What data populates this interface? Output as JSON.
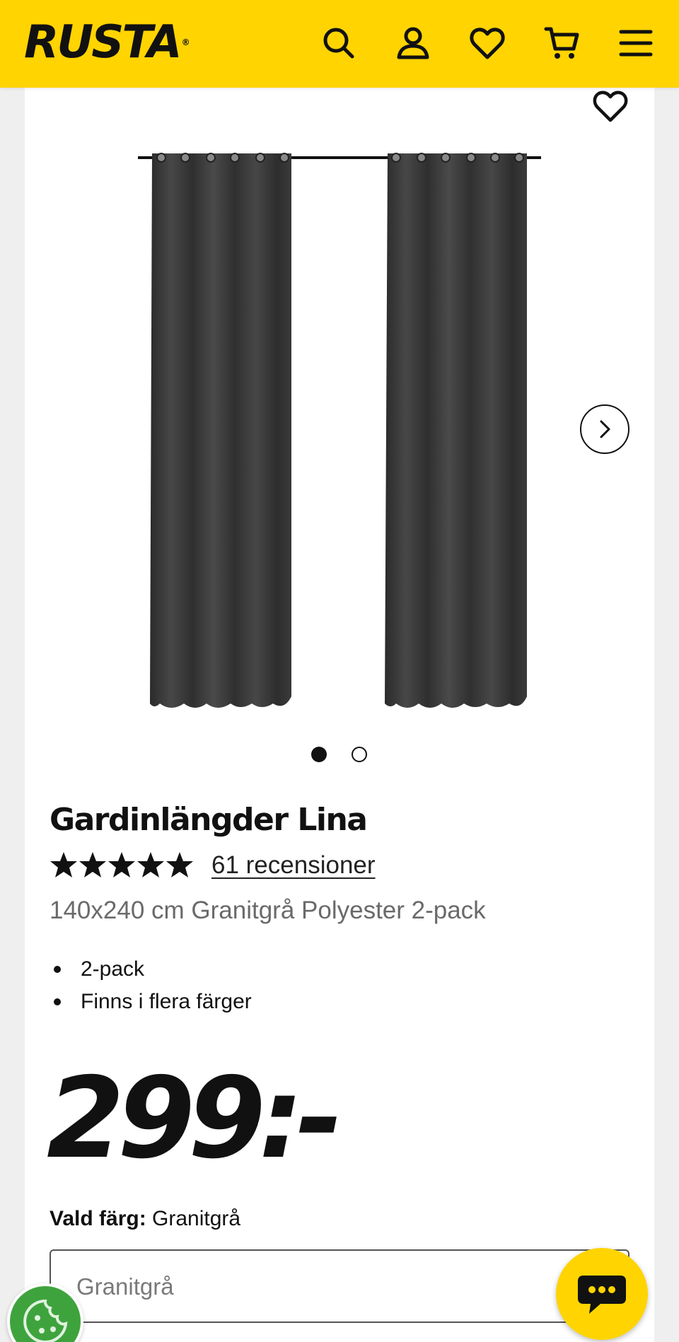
{
  "header": {
    "logo_text": "RUSTA",
    "logo_mark": "®",
    "background_color": "#ffd400",
    "icons": [
      "search-icon",
      "account-icon",
      "wishlist-icon",
      "cart-icon",
      "menu-icon"
    ]
  },
  "product": {
    "title": "Gardinlängder Lina",
    "rating": 5,
    "rating_max": 5,
    "reviews_label": "61 recensioner",
    "subtitle": "140x240 cm Granitgrå Polyester 2-pack",
    "features": [
      "2-pack",
      "Finns i flera färger"
    ],
    "price": "299:-",
    "selected_color_label": "Vald färg:",
    "selected_color_value": "Granitgrå",
    "color_select_value": "Granitgrå"
  },
  "gallery": {
    "image_count": 2,
    "active_index": 0,
    "curtain_color": "#3a3a3a"
  },
  "floating": {
    "chat_color": "#ffd400",
    "cookie_color": "#3fa33d"
  }
}
